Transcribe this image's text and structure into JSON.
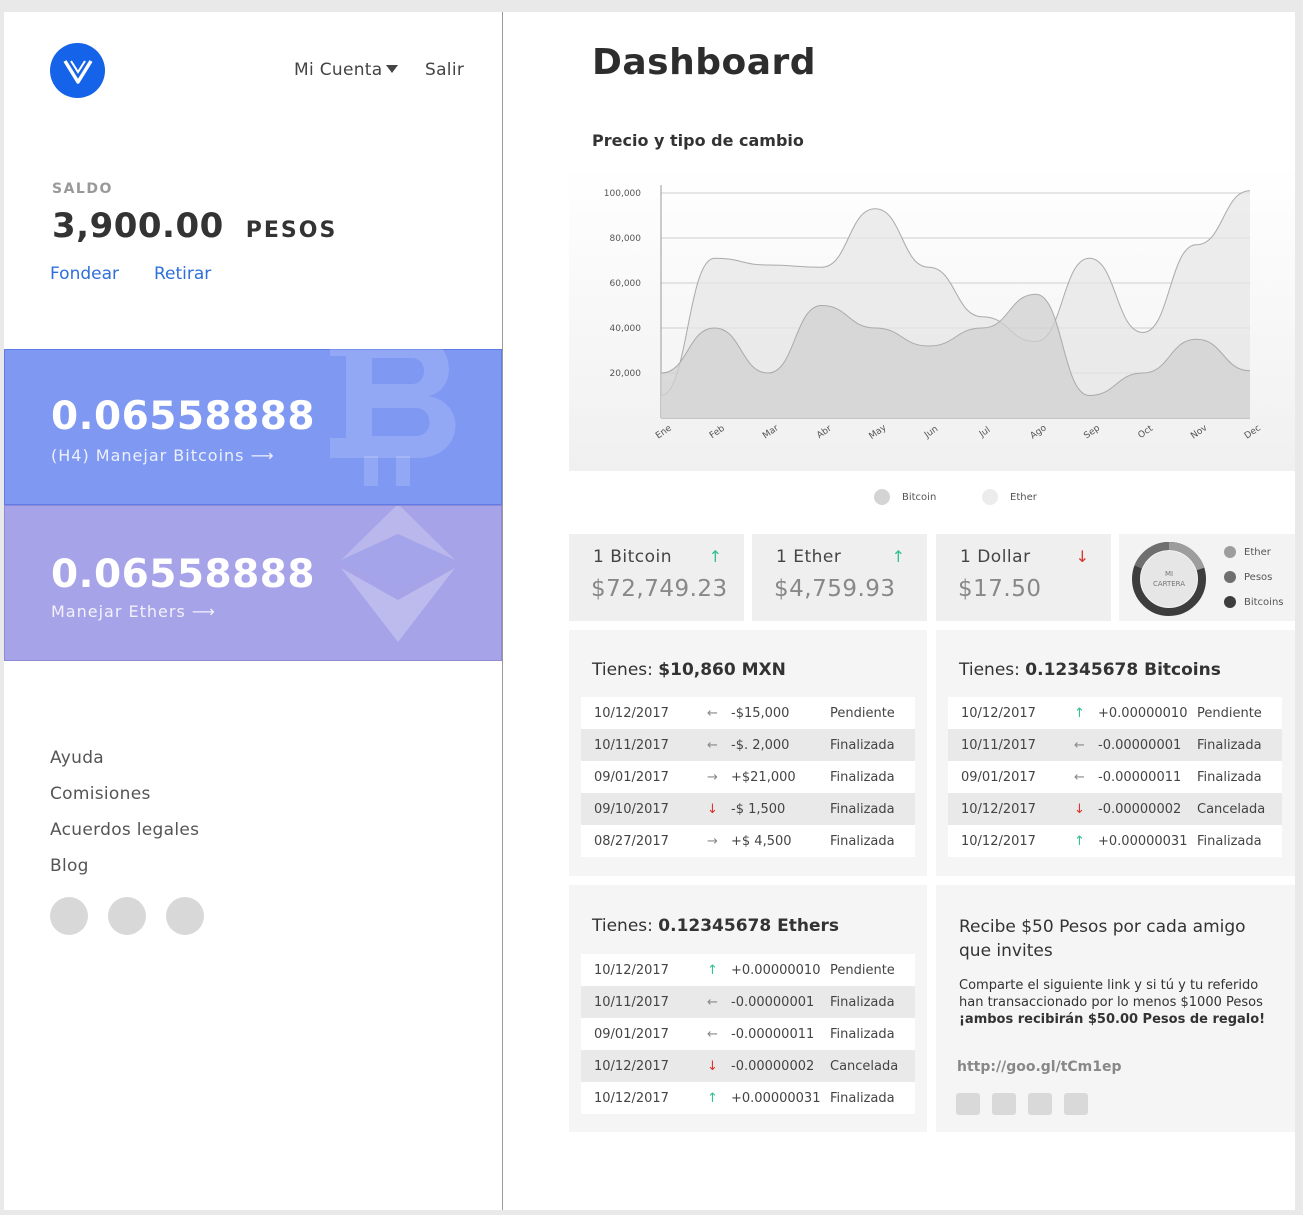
{
  "header": {
    "logo_letter": "V",
    "my_account": "Mi Cuenta",
    "logout": "Salir"
  },
  "balance": {
    "label": "SALDO",
    "amount": "3,900.00",
    "currency": "PESOS",
    "fund": "Fondear",
    "withdraw": "Retirar"
  },
  "wallets": {
    "bitcoin": {
      "amount": "0.06558888",
      "link": "(H4) Manejar Bitcoins",
      "color": "#7f98f2"
    },
    "ether": {
      "amount": "0.06558888",
      "link": "Manejar Ethers",
      "color": "#a7a3e8"
    }
  },
  "footer": {
    "links": [
      "Ayuda",
      "Comisiones",
      "Acuerdos legales",
      "Blog"
    ]
  },
  "main": {
    "title": "Dashboard",
    "chart_title": "Precio y tipo de cambio"
  },
  "chart_data": {
    "type": "area",
    "title": "Precio y tipo de cambio",
    "categories": [
      "Ene",
      "Feb",
      "Mar",
      "Abr",
      "May",
      "Jun",
      "Jul",
      "Ago",
      "Sep",
      "Oct",
      "Nov",
      "Dec"
    ],
    "yticks": [
      "100,000",
      "80,000",
      "60,000",
      "40,000",
      "20,000"
    ],
    "ylim": [
      0,
      100000
    ],
    "series": [
      {
        "name": "Bitcoin",
        "values": [
          20000,
          40000,
          20000,
          50000,
          40000,
          32000,
          40000,
          55000,
          10000,
          20000,
          35000,
          21000
        ],
        "color": "#d0d0d0"
      },
      {
        "name": "Ether",
        "values": [
          10000,
          71000,
          68000,
          67000,
          93000,
          67000,
          45000,
          34000,
          71000,
          38000,
          77000,
          101000
        ],
        "color": "#e6e6e6"
      }
    ],
    "legend_position": "bottom",
    "grid": true
  },
  "rates": [
    {
      "name": "1 Bitcoin",
      "value": "$72,749.23",
      "arrow": "↑",
      "trend": "up"
    },
    {
      "name": "1 Ether",
      "value": "$4,759.93",
      "arrow": "↑",
      "trend": "up"
    },
    {
      "name": "1 Dollar",
      "value": "$17.50",
      "arrow": "↓",
      "trend": "down"
    }
  ],
  "portfolio": {
    "label_line1": "MI",
    "label_line2": "CARTERA",
    "legend": [
      {
        "name": "Ether",
        "color": "#9d9d9d"
      },
      {
        "name": "Pesos",
        "color": "#6f6f6f"
      },
      {
        "name": "Bitcoins",
        "color": "#3d3d3d"
      }
    ]
  },
  "panels": {
    "mxn": {
      "title_prefix": "Tienes:",
      "title_value": "$10,860 MXN",
      "rows": [
        {
          "date": "10/12/2017",
          "arrow": "←",
          "trend": "left",
          "amount": "-$15,000",
          "status": "Pendiente"
        },
        {
          "date": "10/11/2017",
          "arrow": "←",
          "trend": "left",
          "amount": "-$. 2,000",
          "status": "Finalizada"
        },
        {
          "date": "09/01/2017",
          "arrow": "→",
          "trend": "right",
          "amount": "+$21,000",
          "status": "Finalizada"
        },
        {
          "date": "09/10/2017",
          "arrow": "↓",
          "trend": "down",
          "amount": "-$ 1,500",
          "status": "Finalizada"
        },
        {
          "date": "08/27/2017",
          "arrow": "→",
          "trend": "right",
          "amount": "+$  4,500",
          "status": "Finalizada"
        }
      ]
    },
    "btc": {
      "title_prefix": "Tienes:",
      "title_value": "0.12345678 Bitcoins",
      "rows": [
        {
          "date": "10/12/2017",
          "arrow": "↑",
          "trend": "up",
          "amount": "+0.00000010",
          "status": "Pendiente"
        },
        {
          "date": "10/11/2017",
          "arrow": "←",
          "trend": "left",
          "amount": "-0.00000001",
          "status": "Finalizada"
        },
        {
          "date": "09/01/2017",
          "arrow": "←",
          "trend": "left",
          "amount": "-0.00000011",
          "status": "Finalizada"
        },
        {
          "date": "10/12/2017",
          "arrow": "↓",
          "trend": "down",
          "amount": "-0.00000002",
          "status": "Cancelada"
        },
        {
          "date": "10/12/2017",
          "arrow": "↑",
          "trend": "up",
          "amount": "+0.00000031",
          "status": "Finalizada"
        }
      ]
    },
    "eth": {
      "title_prefix": "Tienes:",
      "title_value": "0.12345678 Ethers",
      "rows": [
        {
          "date": "10/12/2017",
          "arrow": "↑",
          "trend": "up",
          "amount": "+0.00000010",
          "status": "Pendiente"
        },
        {
          "date": "10/11/2017",
          "arrow": "←",
          "trend": "left",
          "amount": "-0.00000001",
          "status": "Finalizada"
        },
        {
          "date": "09/01/2017",
          "arrow": "←",
          "trend": "left",
          "amount": "-0.00000011",
          "status": "Finalizada"
        },
        {
          "date": "10/12/2017",
          "arrow": "↓",
          "trend": "down",
          "amount": "-0.00000002",
          "status": "Cancelada"
        },
        {
          "date": "10/12/2017",
          "arrow": "↑",
          "trend": "up",
          "amount": "+0.00000031",
          "status": "Finalizada"
        }
      ]
    }
  },
  "referral": {
    "title": "Recibe $50 Pesos por cada amigo que invites",
    "text": "Comparte el siguiente link y si tú y tu referido han transaccionado por lo menos $1000 Pesos",
    "bold_text": "¡ambos recibirán $50.00 Pesos de regalo!",
    "link": "http://goo.gl/tCm1ep"
  }
}
